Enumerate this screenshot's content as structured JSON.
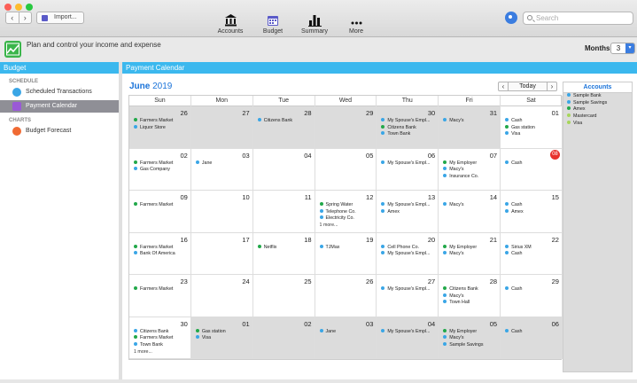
{
  "colors": {
    "blue": "#3aa6e6",
    "green": "#22a84a",
    "lightgreen": "#a7d65a",
    "header": "#3bb8ee",
    "accent": "#1a73d9",
    "today": "#e8312c"
  },
  "toolbar": {
    "back_icon": "chevron-left-icon",
    "forward_icon": "chevron-right-icon",
    "import_label": "Import...",
    "items": [
      {
        "label": "Accounts",
        "icon": "bank-icon"
      },
      {
        "label": "Budget",
        "icon": "calendar-icon"
      },
      {
        "label": "Summary",
        "icon": "bar-chart-icon"
      },
      {
        "label": "More",
        "icon": "more-icon"
      }
    ],
    "search_placeholder": "Search"
  },
  "infobar": {
    "tagline": "Plan and control your income and expense",
    "months_label": "Months",
    "months_value": "3"
  },
  "sidebar": {
    "title": "Budget",
    "sections": [
      {
        "label": "SCHEDULE",
        "items": [
          {
            "label": "Scheduled Transactions",
            "icon": "list-icon",
            "selected": false
          },
          {
            "label": "Payment Calendar",
            "icon": "calendar-icon",
            "selected": true
          }
        ]
      },
      {
        "label": "CHARTS",
        "items": [
          {
            "label": "Budget Forecast",
            "icon": "chart-icon",
            "selected": false
          }
        ]
      }
    ]
  },
  "main": {
    "title": "Payment Calendar",
    "month": "June",
    "year": "2019",
    "today_label": "Today",
    "weekdays": [
      "Sun",
      "Mon",
      "Tue",
      "Wed",
      "Thu",
      "Fri",
      "Sat"
    ]
  },
  "calendar": {
    "days": [
      {
        "n": "26",
        "other": true,
        "events": [
          [
            "Farmers Market",
            "green"
          ],
          [
            "Liquor Store",
            "blue"
          ]
        ]
      },
      {
        "n": "27",
        "other": true,
        "events": []
      },
      {
        "n": "28",
        "other": true,
        "events": [
          [
            "Citizens Bank",
            "blue"
          ]
        ]
      },
      {
        "n": "29",
        "other": true,
        "events": []
      },
      {
        "n": "30",
        "other": true,
        "events": [
          [
            "My Spouse's Empl...",
            "blue"
          ],
          [
            "Citizens Bank",
            "green"
          ],
          [
            "Town Bank",
            "blue"
          ]
        ]
      },
      {
        "n": "31",
        "other": true,
        "events": [
          [
            "Macy's",
            "blue"
          ]
        ]
      },
      {
        "n": "01",
        "other": false,
        "events": [
          [
            "Cash",
            "blue"
          ],
          [
            "Gas station",
            "green"
          ],
          [
            "Visa",
            "blue"
          ]
        ]
      },
      {
        "n": "02",
        "other": false,
        "events": [
          [
            "Farmers Market",
            "green"
          ],
          [
            "Gas Company",
            "blue"
          ]
        ]
      },
      {
        "n": "03",
        "other": false,
        "events": [
          [
            "Jane",
            "blue"
          ]
        ]
      },
      {
        "n": "04",
        "other": false,
        "events": []
      },
      {
        "n": "05",
        "other": false,
        "events": []
      },
      {
        "n": "06",
        "other": false,
        "events": [
          [
            "My Spouse's Empl...",
            "blue"
          ]
        ]
      },
      {
        "n": "07",
        "other": false,
        "events": [
          [
            "My Employer",
            "green"
          ],
          [
            "Macy's",
            "blue"
          ],
          [
            "Insurance Co.",
            "blue"
          ]
        ]
      },
      {
        "n": "08",
        "other": false,
        "today": true,
        "events": [
          [
            "Cash",
            "blue"
          ]
        ]
      },
      {
        "n": "09",
        "other": false,
        "events": [
          [
            "Farmers Market",
            "green"
          ]
        ]
      },
      {
        "n": "10",
        "other": false,
        "events": []
      },
      {
        "n": "11",
        "other": false,
        "events": []
      },
      {
        "n": "12",
        "other": false,
        "events": [
          [
            "Spring Water",
            "green"
          ],
          [
            "Telephone Co.",
            "blue"
          ],
          [
            "Electricity Co.",
            "blue"
          ]
        ],
        "more": "1 more..."
      },
      {
        "n": "13",
        "other": false,
        "events": [
          [
            "My Spouse's Empl...",
            "blue"
          ],
          [
            "Amex",
            "blue"
          ]
        ]
      },
      {
        "n": "14",
        "other": false,
        "events": [
          [
            "Macy's",
            "blue"
          ]
        ]
      },
      {
        "n": "15",
        "other": false,
        "events": [
          [
            "Cash",
            "blue"
          ],
          [
            "Amex",
            "blue"
          ]
        ]
      },
      {
        "n": "16",
        "other": false,
        "events": [
          [
            "Farmers Market",
            "green"
          ],
          [
            "Bank Of America",
            "blue"
          ]
        ]
      },
      {
        "n": "17",
        "other": false,
        "events": []
      },
      {
        "n": "18",
        "other": false,
        "events": [
          [
            "Netflix",
            "green"
          ]
        ]
      },
      {
        "n": "19",
        "other": false,
        "events": [
          [
            "TJMax",
            "blue"
          ]
        ]
      },
      {
        "n": "20",
        "other": false,
        "events": [
          [
            "Cell Phone Co.",
            "blue"
          ],
          [
            "My Spouse's Empl...",
            "blue"
          ]
        ]
      },
      {
        "n": "21",
        "other": false,
        "events": [
          [
            "My Employer",
            "green"
          ],
          [
            "Macy's",
            "blue"
          ]
        ]
      },
      {
        "n": "22",
        "other": false,
        "events": [
          [
            "Sirius XM",
            "blue"
          ],
          [
            "Cash",
            "blue"
          ]
        ]
      },
      {
        "n": "23",
        "other": false,
        "events": [
          [
            "Farmers Market",
            "green"
          ]
        ]
      },
      {
        "n": "24",
        "other": false,
        "events": []
      },
      {
        "n": "25",
        "other": false,
        "events": []
      },
      {
        "n": "26",
        "other": false,
        "events": []
      },
      {
        "n": "27",
        "other": false,
        "events": [
          [
            "My Spouse's Empl...",
            "blue"
          ]
        ]
      },
      {
        "n": "28",
        "other": false,
        "events": [
          [
            "Citizens Bank",
            "green"
          ],
          [
            "Macy's",
            "blue"
          ],
          [
            "Town Hall",
            "blue"
          ]
        ]
      },
      {
        "n": "29",
        "other": false,
        "events": [
          [
            "Cash",
            "blue"
          ]
        ]
      },
      {
        "n": "30",
        "other": false,
        "events": [
          [
            "Citizens Bank",
            "blue"
          ],
          [
            "Farmers Market",
            "green"
          ],
          [
            "Town Bank",
            "blue"
          ]
        ],
        "more": "1 more..."
      },
      {
        "n": "01",
        "other": true,
        "events": [
          [
            "Gas station",
            "green"
          ],
          [
            "Visa",
            "blue"
          ]
        ]
      },
      {
        "n": "02",
        "other": true,
        "events": []
      },
      {
        "n": "03",
        "other": true,
        "events": [
          [
            "Jane",
            "blue"
          ]
        ]
      },
      {
        "n": "04",
        "other": true,
        "events": [
          [
            "My Spouse's Empl...",
            "blue"
          ]
        ]
      },
      {
        "n": "05",
        "other": true,
        "events": [
          [
            "My Employer",
            "green"
          ],
          [
            "Macy's",
            "blue"
          ],
          [
            "Sample Savings",
            "blue"
          ]
        ]
      },
      {
        "n": "06",
        "other": true,
        "events": [
          [
            "Cash",
            "blue"
          ]
        ]
      }
    ]
  },
  "accounts": {
    "title": "Accounts",
    "items": [
      [
        "Sample Bank",
        "blue"
      ],
      [
        "Sample Savings",
        "blue"
      ],
      [
        "Amex",
        "green"
      ],
      [
        "Mastercard",
        "lightgreen"
      ],
      [
        "Visa",
        "lightgreen"
      ]
    ]
  }
}
